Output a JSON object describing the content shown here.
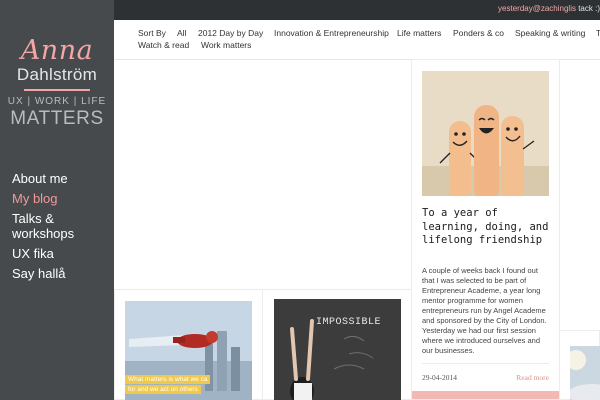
{
  "brand": {
    "name_first": "Anna",
    "name_last": "Dahlström",
    "tagline": "UX | WORK | LIFE",
    "matters": "MATTERS",
    "accent_color": "#f2a6a6"
  },
  "sidebar": {
    "items": [
      {
        "label": "About me",
        "active": false
      },
      {
        "label": "My blog",
        "active": true
      },
      {
        "label": "Talks &\nworkshops",
        "active": false
      },
      {
        "label": "UX fika",
        "active": false
      },
      {
        "label": "Say hallå",
        "active": false
      }
    ]
  },
  "topbar": {
    "tweet_prefix": "yesterday",
    "tweet_user": "@zachinglis",
    "tweet_text": " tack :)"
  },
  "filters": {
    "sort_by": "Sort By",
    "items": [
      "All",
      "2012 Day by Day",
      "Innovation & Entrepreneurship",
      "Life matters",
      "Ponders & co",
      "Speaking & writing",
      "T",
      "Watch & read",
      "Work matters"
    ]
  },
  "feature_post": {
    "image_icon": "smiling-fingers-photo",
    "title": "To a year of learning, doing, and lifelong friendship",
    "excerpt": "A couple of weeks back I found out that I was selected to be part of Entrepreneur Academe, a year long mentor programme for women entrepreneurs run by Angel Academe and sponsored by the City of London. Yesterday we had our first session where we introduced ourselves and our businesses.",
    "date": "29-04-2014",
    "read_more": "Read more"
  },
  "post_a": {
    "image_icon": "flying-superhero-photo",
    "quote_line1": "What matters is what we ca",
    "quote_line2": "for and we act on others"
  },
  "post_b": {
    "image_icon": "chalkboard-impossible-photo",
    "board_word": "IMPOSSIBLE"
  },
  "post_c": {
    "image_icon": "sky-photo"
  }
}
